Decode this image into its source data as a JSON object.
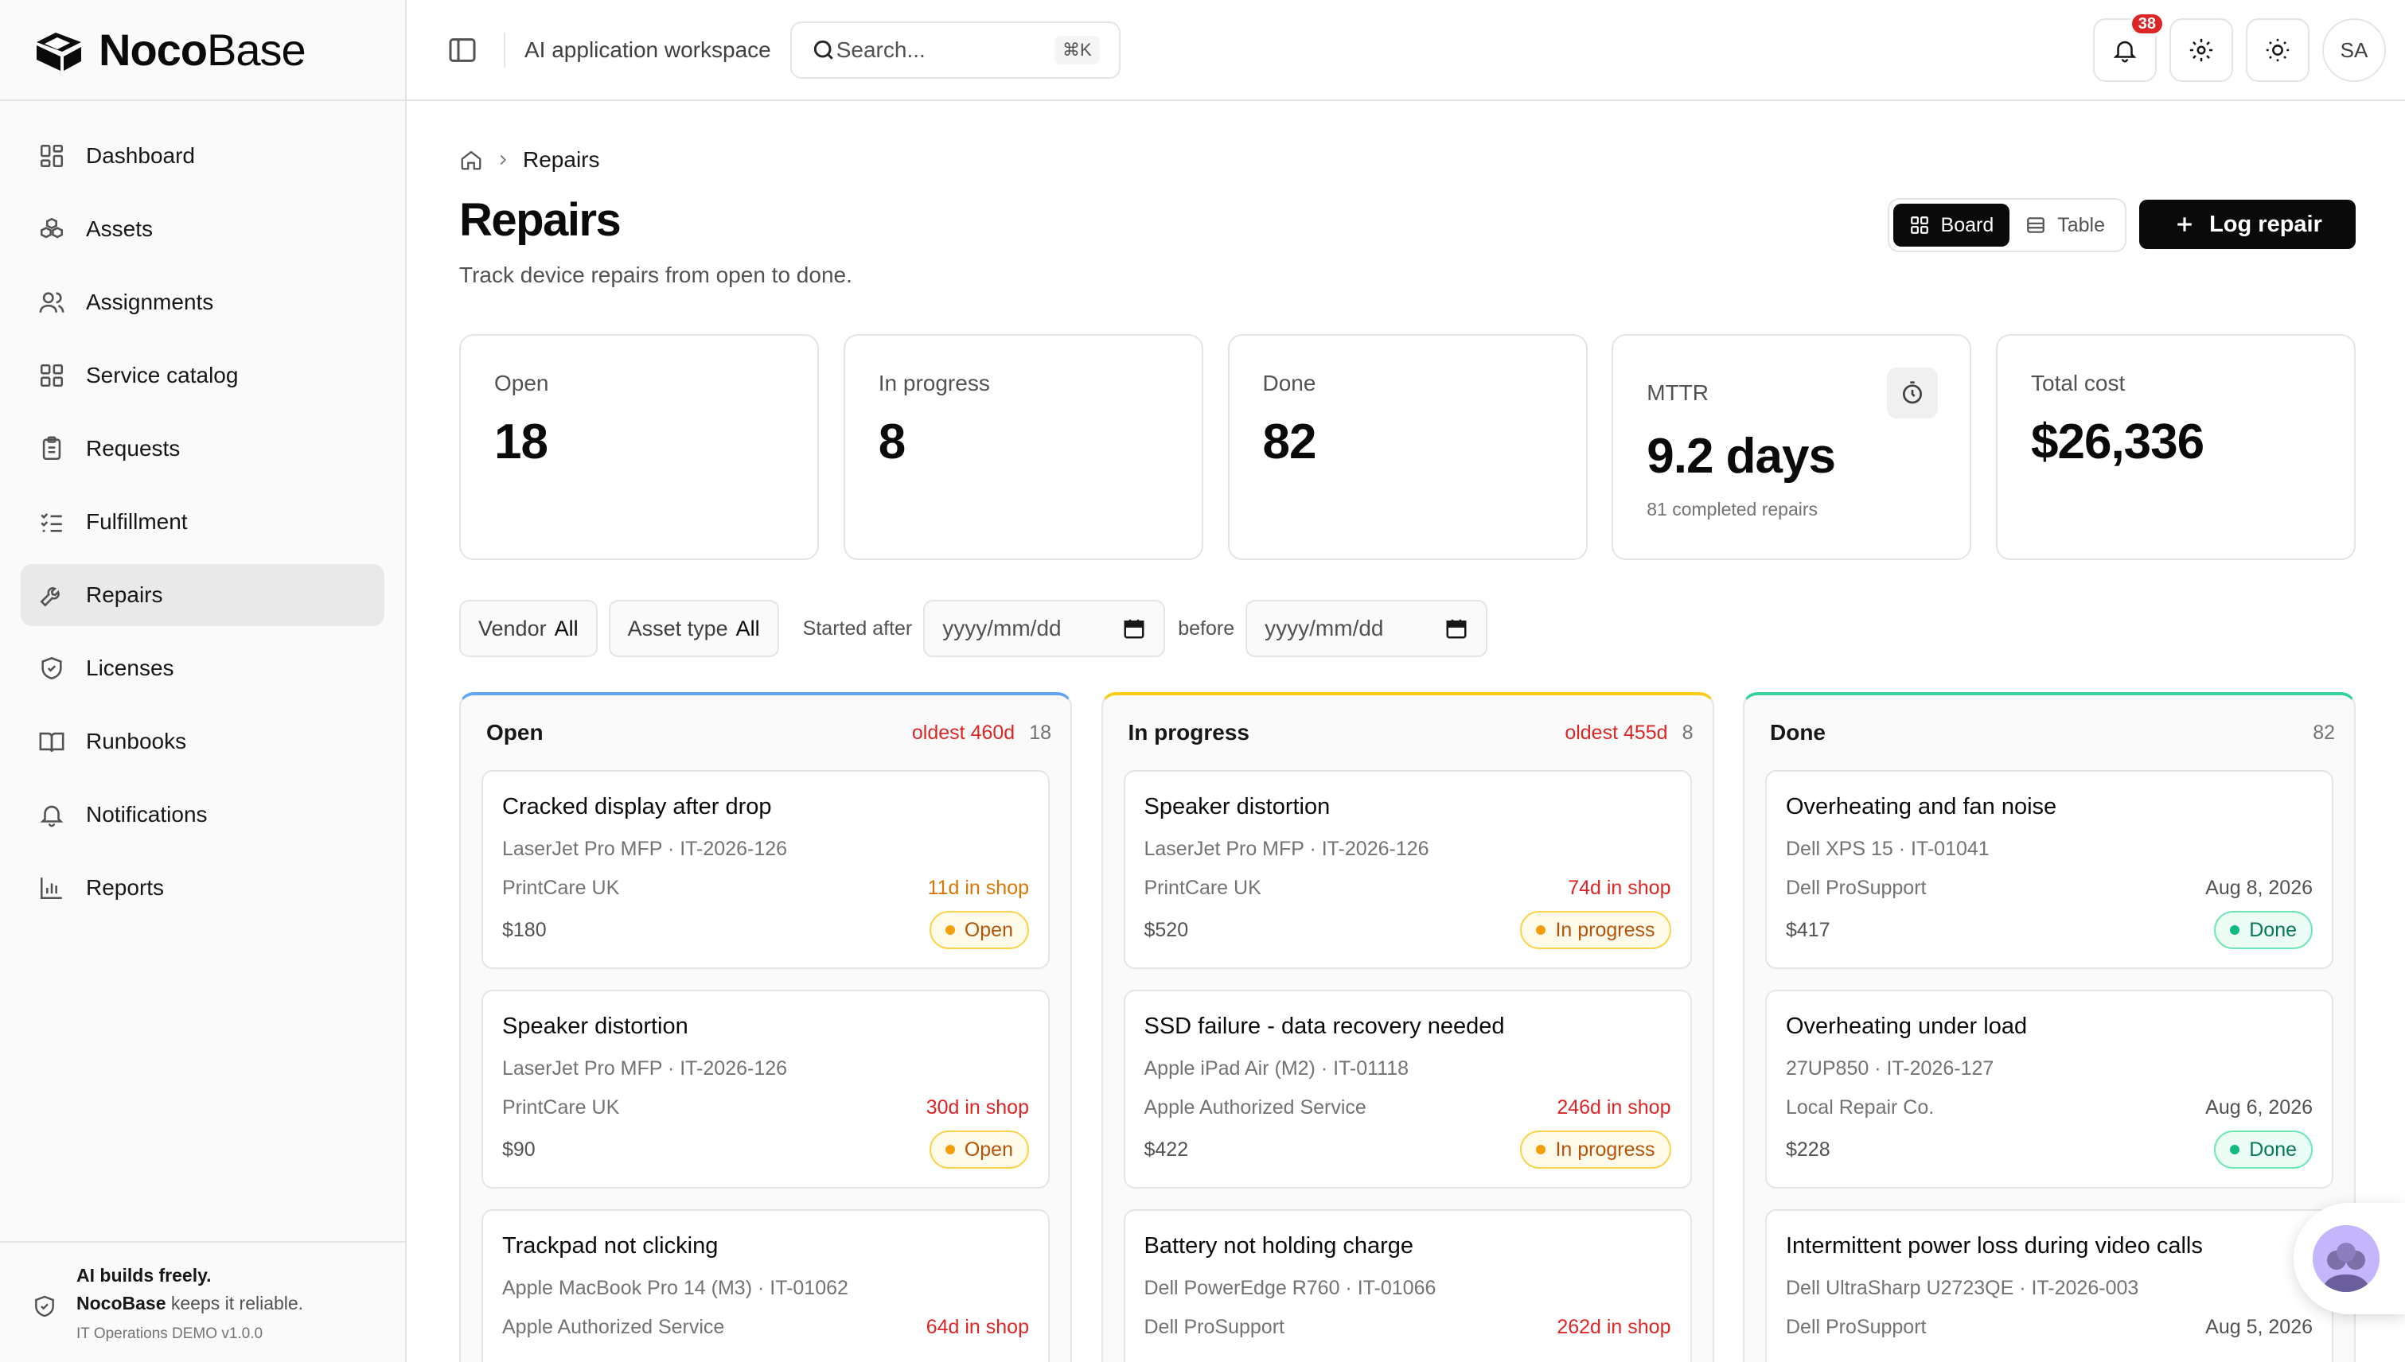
{
  "app": {
    "logo_bold": "Noco",
    "logo_light": "Base"
  },
  "sidebar": {
    "items": [
      {
        "label": "Dashboard",
        "icon": "dashboard-icon"
      },
      {
        "label": "Assets",
        "icon": "boxes-icon"
      },
      {
        "label": "Assignments",
        "icon": "users-icon"
      },
      {
        "label": "Service catalog",
        "icon": "grid-icon"
      },
      {
        "label": "Requests",
        "icon": "clipboard-icon"
      },
      {
        "label": "Fulfillment",
        "icon": "checklist-icon"
      },
      {
        "label": "Repairs",
        "icon": "wrench-icon",
        "active": true
      },
      {
        "label": "Licenses",
        "icon": "shield-icon"
      },
      {
        "label": "Runbooks",
        "icon": "book-icon"
      },
      {
        "label": "Notifications",
        "icon": "bell-icon"
      },
      {
        "label": "Reports",
        "icon": "bar-chart-icon"
      }
    ],
    "footer": {
      "line1": "AI builds freely.",
      "line2_brand": "NocoBase",
      "line2_rest": " keeps it reliable.",
      "version": "IT Operations DEMO v1.0.0"
    }
  },
  "header": {
    "workspace": "AI application workspace",
    "search_placeholder": "Search...",
    "search_shortcut": "⌘K",
    "notification_count": "38",
    "avatar_initials": "SA"
  },
  "page": {
    "breadcrumb": "Repairs",
    "title": "Repairs",
    "subtitle": "Track device repairs from open to done.",
    "view_board": "Board",
    "view_table": "Table",
    "active_view": "Board",
    "log_button": "Log repair"
  },
  "stats": [
    {
      "label": "Open",
      "value": "18"
    },
    {
      "label": "In progress",
      "value": "8"
    },
    {
      "label": "Done",
      "value": "82"
    },
    {
      "label": "MTTR",
      "value": "9.2 days",
      "sub": "81 completed repairs"
    },
    {
      "label": "Total cost",
      "value": "$26,336"
    }
  ],
  "filters": {
    "vendor_label": "Vendor",
    "vendor_value": "All",
    "asset_type_label": "Asset type",
    "asset_type_value": "All",
    "started_after_label": "Started after",
    "started_after_placeholder": "yyyy/mm/dd",
    "before_label": "before",
    "before_placeholder": "yyyy/mm/dd"
  },
  "columns": [
    {
      "title": "Open",
      "oldest": "oldest 460d",
      "count": "18",
      "accent": "#60a5fa",
      "cards": [
        {
          "title": "Cracked display after drop",
          "meta": "LaserJet Pro MFP · IT-2026-126",
          "vendor": "PrintCare UK",
          "age": "11d in shop",
          "age_color": "#d97706",
          "cost": "$180",
          "status": "Open"
        },
        {
          "title": "Speaker distortion",
          "meta": "LaserJet Pro MFP · IT-2026-126",
          "vendor": "PrintCare UK",
          "age": "30d in shop",
          "age_color": "#dc2626",
          "cost": "$90",
          "status": "Open"
        },
        {
          "title": "Trackpad not clicking",
          "meta": "Apple MacBook Pro 14 (M3) · IT-01062",
          "vendor": "Apple Authorized Service",
          "age": "64d in shop",
          "age_color": "#dc2626",
          "cost": "",
          "status": ""
        }
      ]
    },
    {
      "title": "In progress",
      "oldest": "oldest 455d",
      "count": "8",
      "accent": "#facc15",
      "cards": [
        {
          "title": "Speaker distortion",
          "meta": "LaserJet Pro MFP · IT-2026-126",
          "vendor": "PrintCare UK",
          "age": "74d in shop",
          "age_color": "#dc2626",
          "cost": "$520",
          "status": "In progress"
        },
        {
          "title": "SSD failure - data recovery needed",
          "meta": "Apple iPad Air (M2) · IT-01118",
          "vendor": "Apple Authorized Service",
          "age": "246d in shop",
          "age_color": "#dc2626",
          "cost": "$422",
          "status": "In progress"
        },
        {
          "title": "Battery not holding charge",
          "meta": "Dell PowerEdge R760 · IT-01066",
          "vendor": "Dell ProSupport",
          "age": "262d in shop",
          "age_color": "#dc2626",
          "cost": "",
          "status": ""
        }
      ]
    },
    {
      "title": "Done",
      "oldest": "",
      "count": "82",
      "accent": "#34d399",
      "cards": [
        {
          "title": "Overheating and fan noise",
          "meta": "Dell XPS 15 · IT-01041",
          "vendor": "Dell ProSupport",
          "age": "Aug 8, 2026",
          "age_color": "#525252",
          "cost": "$417",
          "status": "Done"
        },
        {
          "title": "Overheating under load",
          "meta": "27UP850 · IT-2026-127",
          "vendor": "Local Repair Co.",
          "age": "Aug 6, 2026",
          "age_color": "#525252",
          "cost": "$228",
          "status": "Done"
        },
        {
          "title": "Intermittent power loss during video calls",
          "meta": "Dell UltraSharp U2723QE · IT-2026-003",
          "vendor": "Dell ProSupport",
          "age": "Aug 5, 2026",
          "age_color": "#525252",
          "cost": "",
          "status": ""
        }
      ]
    }
  ]
}
